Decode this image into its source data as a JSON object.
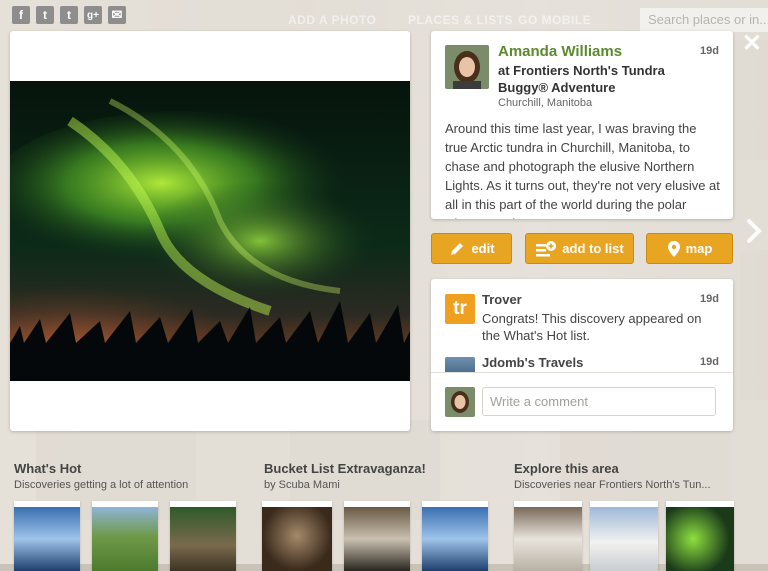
{
  "share": {
    "facebook_glyph": "f",
    "twitter_glyph": "t",
    "tumblr_glyph": "t",
    "googleplus_glyph": "g+",
    "email_glyph": "✉"
  },
  "topnav": {
    "add_photo": "ADD A PHOTO",
    "places_lists": "PLACES & LISTS",
    "go_mobile": "GO MOBILE"
  },
  "search": {
    "placeholder": "Search places or in..."
  },
  "post": {
    "author": "Amanda Williams",
    "age": "19d",
    "place": "at Frontiers North's Tundra Buggy® Adventure",
    "location": "Churchill, Manitoba",
    "description": "Around this time last year, I was braving the true Arctic tundra in Churchill, Manitoba, to chase and photograph the elusive Northern Lights. As it turns out, they're not very elusive at all in this part of the world during the polar winter months!"
  },
  "actions": {
    "edit": "edit",
    "add_to_list": "add to list",
    "map": "map"
  },
  "comments": [
    {
      "name": "Trover",
      "age": "19d",
      "text": "Congrats! This discovery appeared on the What's Hot list.",
      "avatar_text": "tr"
    },
    {
      "name": "Jdomb's Travels",
      "age": "19d",
      "text": ""
    }
  ],
  "comment_box": {
    "placeholder": "Write a comment"
  },
  "sections": [
    {
      "title": "What's Hot",
      "subtitle": "Discoveries getting a lot of attention"
    },
    {
      "title": "Bucket List Extravaganza!",
      "subtitle": "by Scuba Mami"
    },
    {
      "title": "Explore this area",
      "subtitle": "Discoveries near Frontiers North's Tun..."
    }
  ],
  "colors": {
    "accent_orange": "#e8a522",
    "author_green": "#5d8a2f",
    "trover_orange": "#f0a021"
  },
  "icons": {
    "close": "close-icon",
    "next": "chevron-right-icon",
    "edit": "pencil-icon",
    "add_to_list": "list-add-icon",
    "map": "map-pin-icon"
  }
}
